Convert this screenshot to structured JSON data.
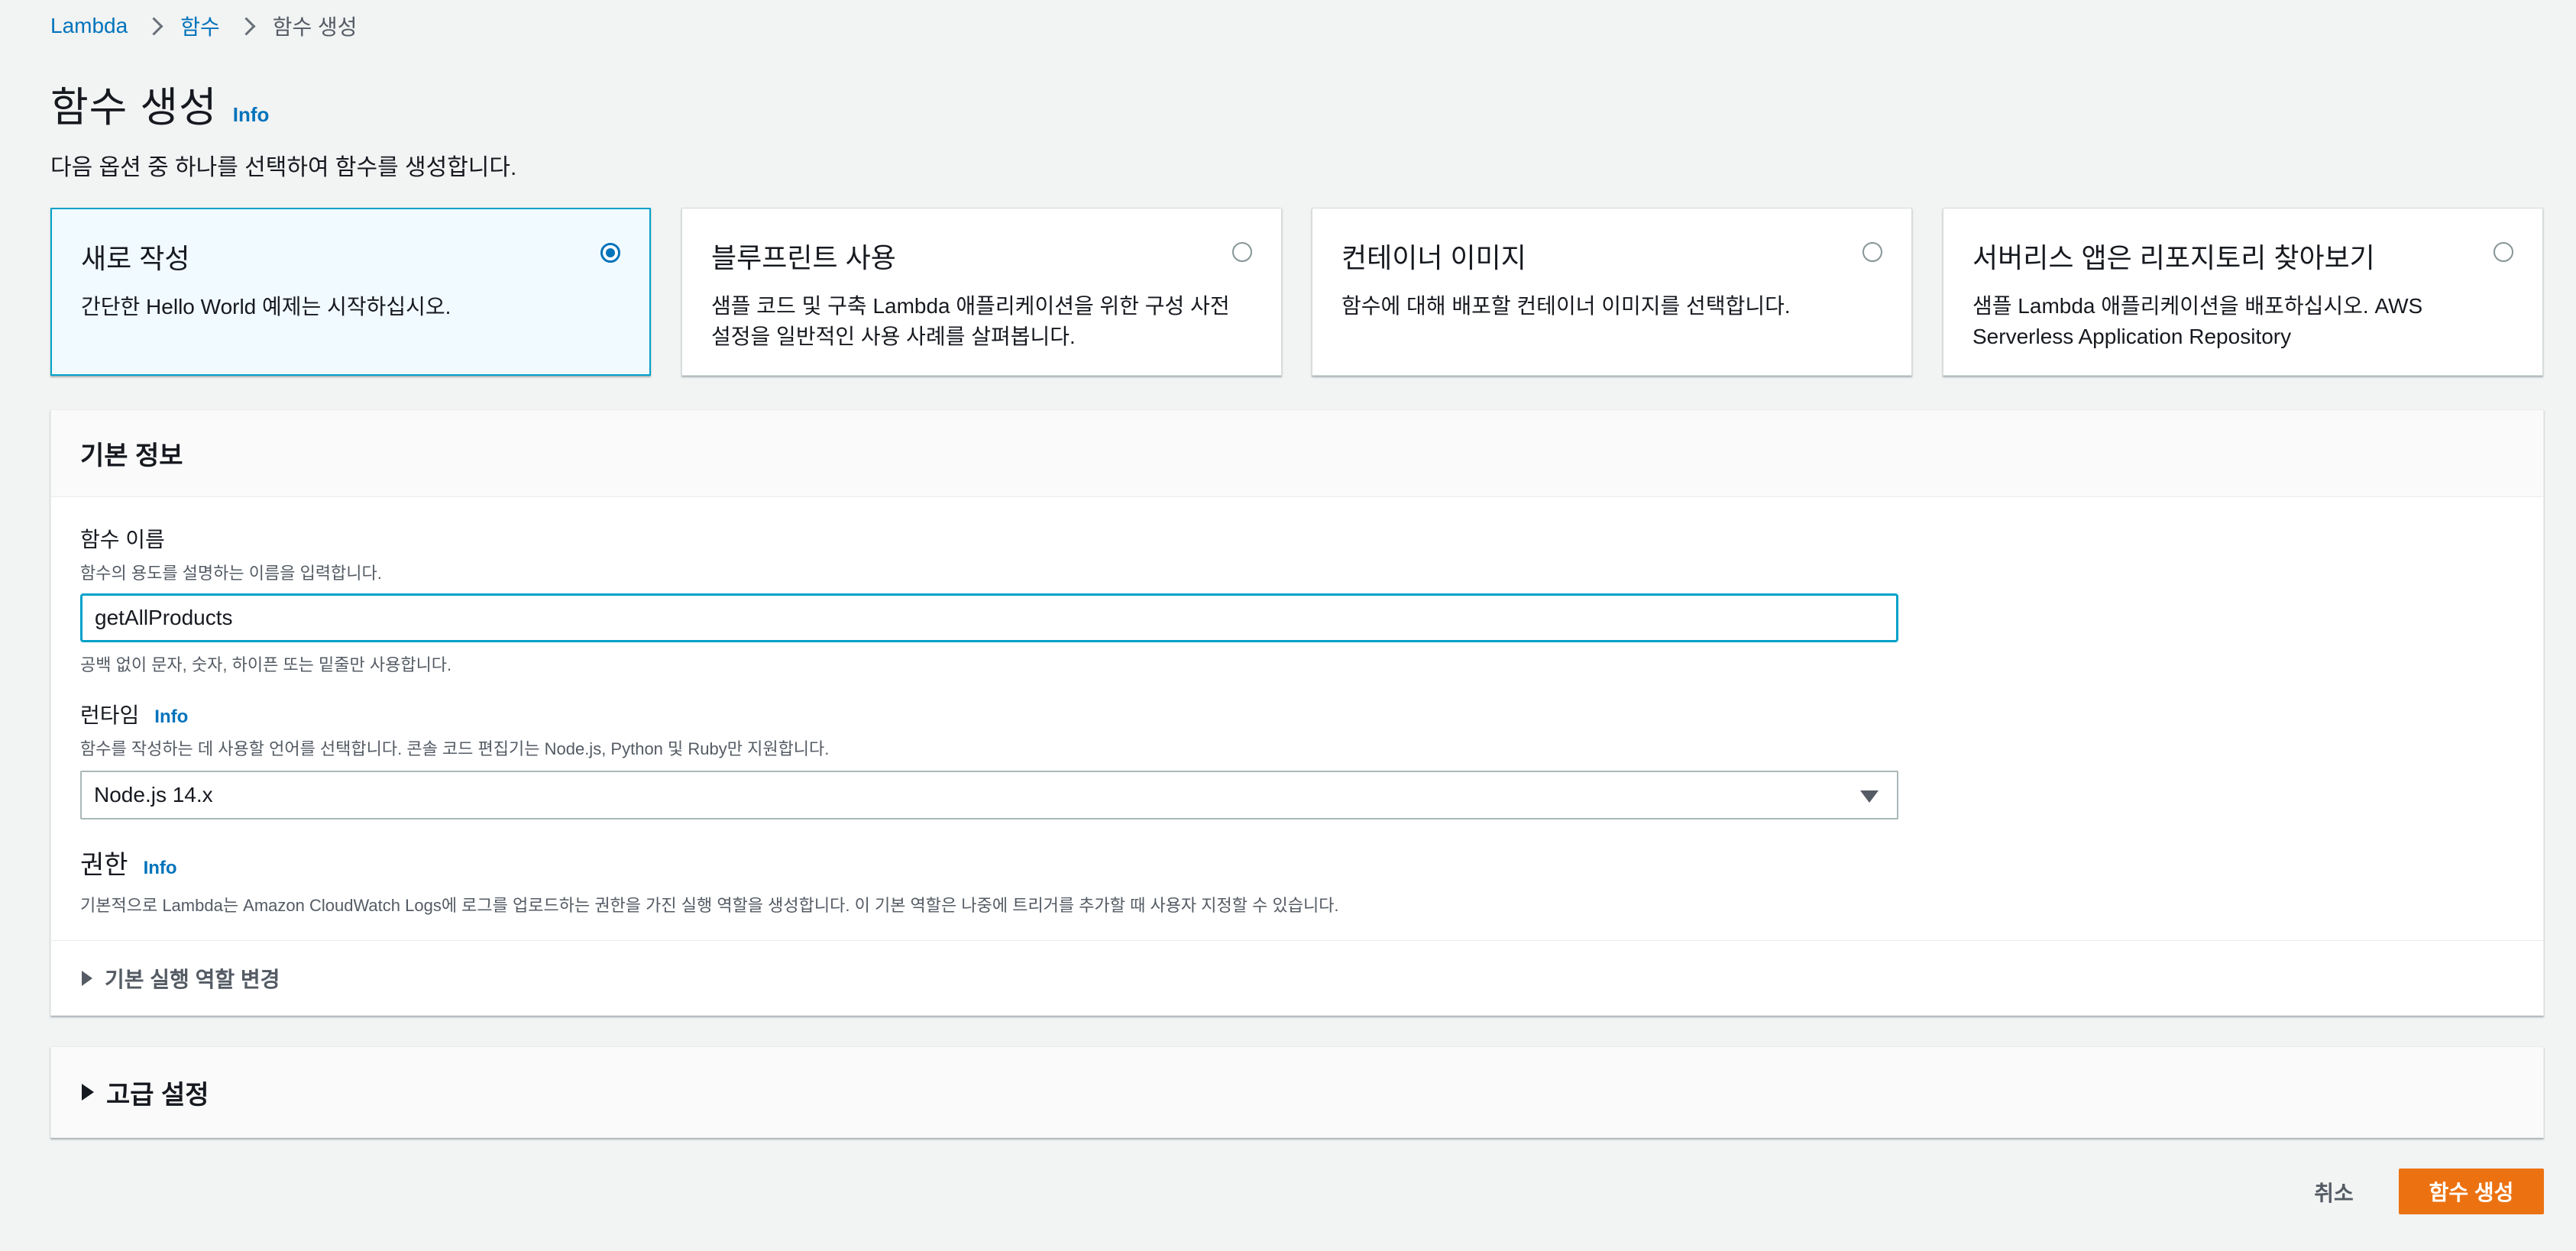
{
  "breadcrumb": {
    "items": [
      "Lambda",
      "함수",
      "함수 생성"
    ]
  },
  "page": {
    "title": "함수 생성",
    "info": "Info",
    "description": "다음 옵션 중 하나를 선택하여 함수를 생성합니다."
  },
  "options": [
    {
      "title": "새로 작성",
      "description": "간단한 Hello World 예제는 시작하십시오.",
      "selected": true
    },
    {
      "title": "블루프린트 사용",
      "description": "샘플 코드 및 구축 Lambda 애플리케이션을 위한 구성 사전 설정을 일반적인 사용 사례를 살펴봅니다.",
      "selected": false
    },
    {
      "title": "컨테이너 이미지",
      "description": "함수에 대해 배포할 컨테이너 이미지를 선택합니다.",
      "selected": false
    },
    {
      "title": "서버리스 앱은 리포지토리 찾아보기",
      "description": "샘플 Lambda 애플리케이션을 배포하십시오. AWS Serverless Application Repository",
      "selected": false
    }
  ],
  "basic_info": {
    "header": "기본 정보",
    "function_name": {
      "label": "함수 이름",
      "description": "함수의 용도를 설명하는 이름을 입력합니다.",
      "value": "getAllProducts",
      "constraint": "공백 없이 문자, 숫자, 하이픈 또는 밑줄만 사용합니다."
    },
    "runtime": {
      "label": "런타임",
      "info": "Info",
      "description": "함수를 작성하는 데 사용할 언어를 선택합니다. 콘솔 코드 편집기는 Node.js, Python 및 Ruby만 지원합니다.",
      "value": "Node.js 14.x"
    },
    "permissions": {
      "title": "권한",
      "info": "Info",
      "description": "기본적으로 Lambda는 Amazon CloudWatch Logs에 로그를 업로드하는 권한을 가진 실행 역할을 생성합니다. 이 기본 역할은 나중에 트리거를 추가할 때 사용자 지정할 수 있습니다."
    },
    "change_role": "기본 실행 역할 변경"
  },
  "advanced": {
    "label": "고급 설정"
  },
  "actions": {
    "cancel": "취소",
    "create": "함수 생성"
  },
  "colors": {
    "accent": "#0073bb",
    "selected_border": "#00a1c9",
    "primary_button": "#ec7211",
    "background": "#f2f3f3"
  }
}
